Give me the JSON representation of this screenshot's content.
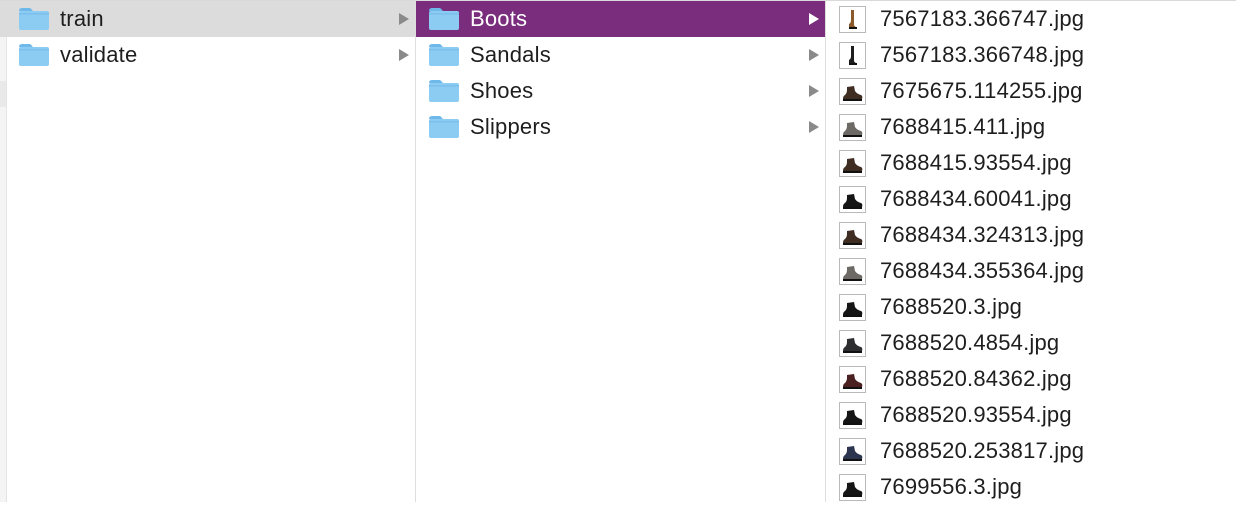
{
  "columns": {
    "root": [
      {
        "label": "train",
        "state": "path-selected",
        "expandable": true
      },
      {
        "label": "validate",
        "state": "",
        "expandable": true
      }
    ],
    "train": [
      {
        "label": "Boots",
        "state": "selected",
        "expandable": true
      },
      {
        "label": "Sandals",
        "state": "",
        "expandable": true
      },
      {
        "label": "Shoes",
        "state": "",
        "expandable": true
      },
      {
        "label": "Slippers",
        "state": "",
        "expandable": true
      }
    ],
    "boots": [
      {
        "label": "7567183.366747.jpg",
        "thumb": "tall-boot-brown"
      },
      {
        "label": "7567183.366748.jpg",
        "thumb": "tall-boot-black"
      },
      {
        "label": "7675675.114255.jpg",
        "thumb": "ankle-boot-dark-brown"
      },
      {
        "label": "7688415.411.jpg",
        "thumb": "ankle-boot-grey"
      },
      {
        "label": "7688415.93554.jpg",
        "thumb": "ankle-boot-dark-brown"
      },
      {
        "label": "7688434.60041.jpg",
        "thumb": "ankle-boot-black"
      },
      {
        "label": "7688434.324313.jpg",
        "thumb": "ankle-boot-dark-brown"
      },
      {
        "label": "7688434.355364.jpg",
        "thumb": "ankle-boot-grey"
      },
      {
        "label": "7688520.3.jpg",
        "thumb": "ankle-boot-black"
      },
      {
        "label": "7688520.4854.jpg",
        "thumb": "ankle-boot-charcoal"
      },
      {
        "label": "7688520.84362.jpg",
        "thumb": "ankle-boot-burgundy"
      },
      {
        "label": "7688520.93554.jpg",
        "thumb": "ankle-boot-black"
      },
      {
        "label": "7688520.253817.jpg",
        "thumb": "ankle-boot-navy"
      },
      {
        "label": "7699556.3.jpg",
        "thumb": "ankle-boot-black"
      }
    ]
  },
  "colors": {
    "selection": "#7a2d7d",
    "path_selection": "#dcdcdc",
    "folder_fill": "#8ccbf2",
    "folder_tab": "#6fb8ea"
  },
  "thumb_colors": {
    "tall-boot-brown": "#8a5a2b",
    "tall-boot-black": "#1d1d1d",
    "ankle-boot-dark-brown": "#3f2d22",
    "ankle-boot-grey": "#6d6a66",
    "ankle-boot-black": "#151515",
    "ankle-boot-charcoal": "#2e2e30",
    "ankle-boot-burgundy": "#4a2020",
    "ankle-boot-navy": "#2b3550"
  }
}
